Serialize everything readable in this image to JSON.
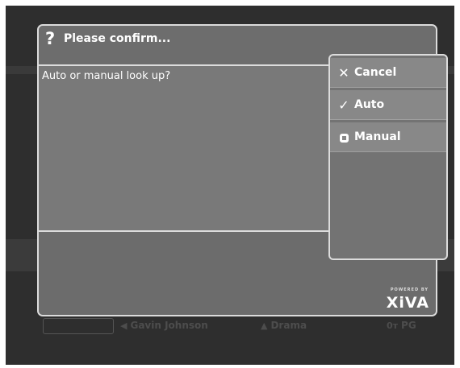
{
  "dialog": {
    "title": "Please confirm...",
    "message": "Auto or manual look up?",
    "powered_by": "POWERED BY",
    "brand": "XiVA"
  },
  "menu": {
    "items": [
      {
        "label": "Cancel",
        "icon": "close-icon"
      },
      {
        "label": "Auto",
        "icon": "check-icon"
      },
      {
        "label": "Manual",
        "icon": "radio-square-icon"
      }
    ]
  },
  "background": {
    "cast": "Gavin Johnson",
    "genre": "Drama",
    "rating": "PG"
  }
}
